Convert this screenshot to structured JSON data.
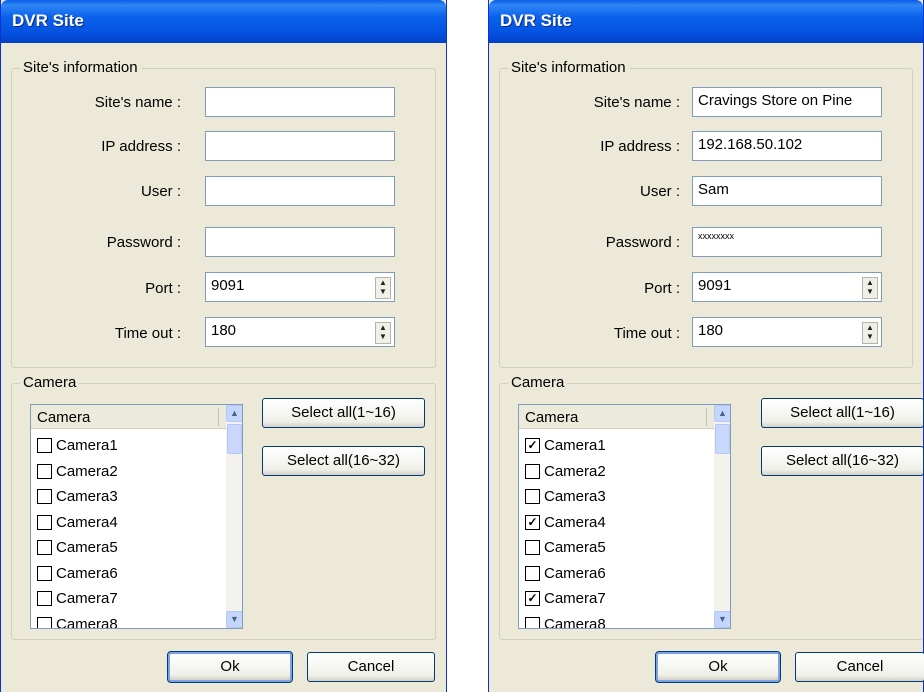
{
  "dialogs": [
    {
      "title": "DVR Site",
      "site_group": "Site's information",
      "labels": {
        "site_name": "Site's name :",
        "ip": "IP address :",
        "user": "User :",
        "password": "Password :",
        "port": "Port :",
        "timeout": "Time out :"
      },
      "values": {
        "site_name": "",
        "ip": "",
        "user": "",
        "password": "",
        "port": "9091",
        "timeout": "180"
      },
      "camera_group": "Camera",
      "camera_header": "Camera",
      "cameras": [
        {
          "label": "Camera1",
          "checked": false
        },
        {
          "label": "Camera2",
          "checked": false
        },
        {
          "label": "Camera3",
          "checked": false
        },
        {
          "label": "Camera4",
          "checked": false
        },
        {
          "label": "Camera5",
          "checked": false
        },
        {
          "label": "Camera6",
          "checked": false
        },
        {
          "label": "Camera7",
          "checked": false
        },
        {
          "label": "Camera8",
          "checked": false
        }
      ],
      "select_all_1": "Select all(1~16)",
      "select_all_2": "Select all(16~32)",
      "ok": "Ok",
      "cancel": "Cancel"
    },
    {
      "title": "DVR Site",
      "site_group": "Site's information",
      "labels": {
        "site_name": "Site's name :",
        "ip": "IP address :",
        "user": "User :",
        "password": "Password :",
        "port": "Port :",
        "timeout": "Time out :"
      },
      "values": {
        "site_name": "Cravings Store on Pine",
        "ip": "192.168.50.102",
        "user": "Sam",
        "password": "xxxxxxxx",
        "port": "9091",
        "timeout": "180"
      },
      "camera_group": "Camera",
      "camera_header": "Camera",
      "cameras": [
        {
          "label": "Camera1",
          "checked": true
        },
        {
          "label": "Camera2",
          "checked": false
        },
        {
          "label": "Camera3",
          "checked": false
        },
        {
          "label": "Camera4",
          "checked": true
        },
        {
          "label": "Camera5",
          "checked": false
        },
        {
          "label": "Camera6",
          "checked": false
        },
        {
          "label": "Camera7",
          "checked": true
        },
        {
          "label": "Camera8",
          "checked": false
        }
      ],
      "select_all_1": "Select all(1~16)",
      "select_all_2": "Select all(16~32)",
      "ok": "Ok",
      "cancel": "Cancel"
    }
  ]
}
